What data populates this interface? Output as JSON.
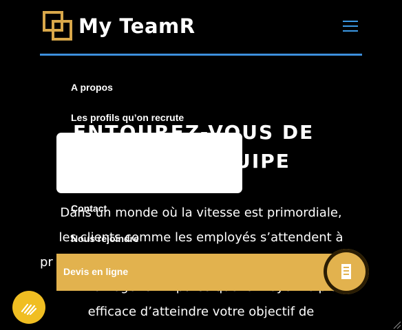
{
  "header": {
    "logo_text": "My TeamR"
  },
  "hero": {
    "title": "ENTOUREZ-VOUS DE LA BONNE ÉQUIPE",
    "paragraph_lines": [
      "Dans un monde où la vitesse est primordiale,",
      "les clients comme les employés s’attendent à",
      "pr",
      "homogène. Et parce que le moyen le plus",
      "efficace d’atteindre votre objectif de"
    ]
  },
  "menu": {
    "items": [
      "A propos",
      "Les profils qu’on recrute",
      "Contact",
      "Nous rejoindre"
    ]
  },
  "cta": {
    "label": "Devis en ligne"
  },
  "colors": {
    "accent_gold": "#e2b24e",
    "nav_blue": "#3d8fdc",
    "fab_yellow": "#f0be22"
  }
}
